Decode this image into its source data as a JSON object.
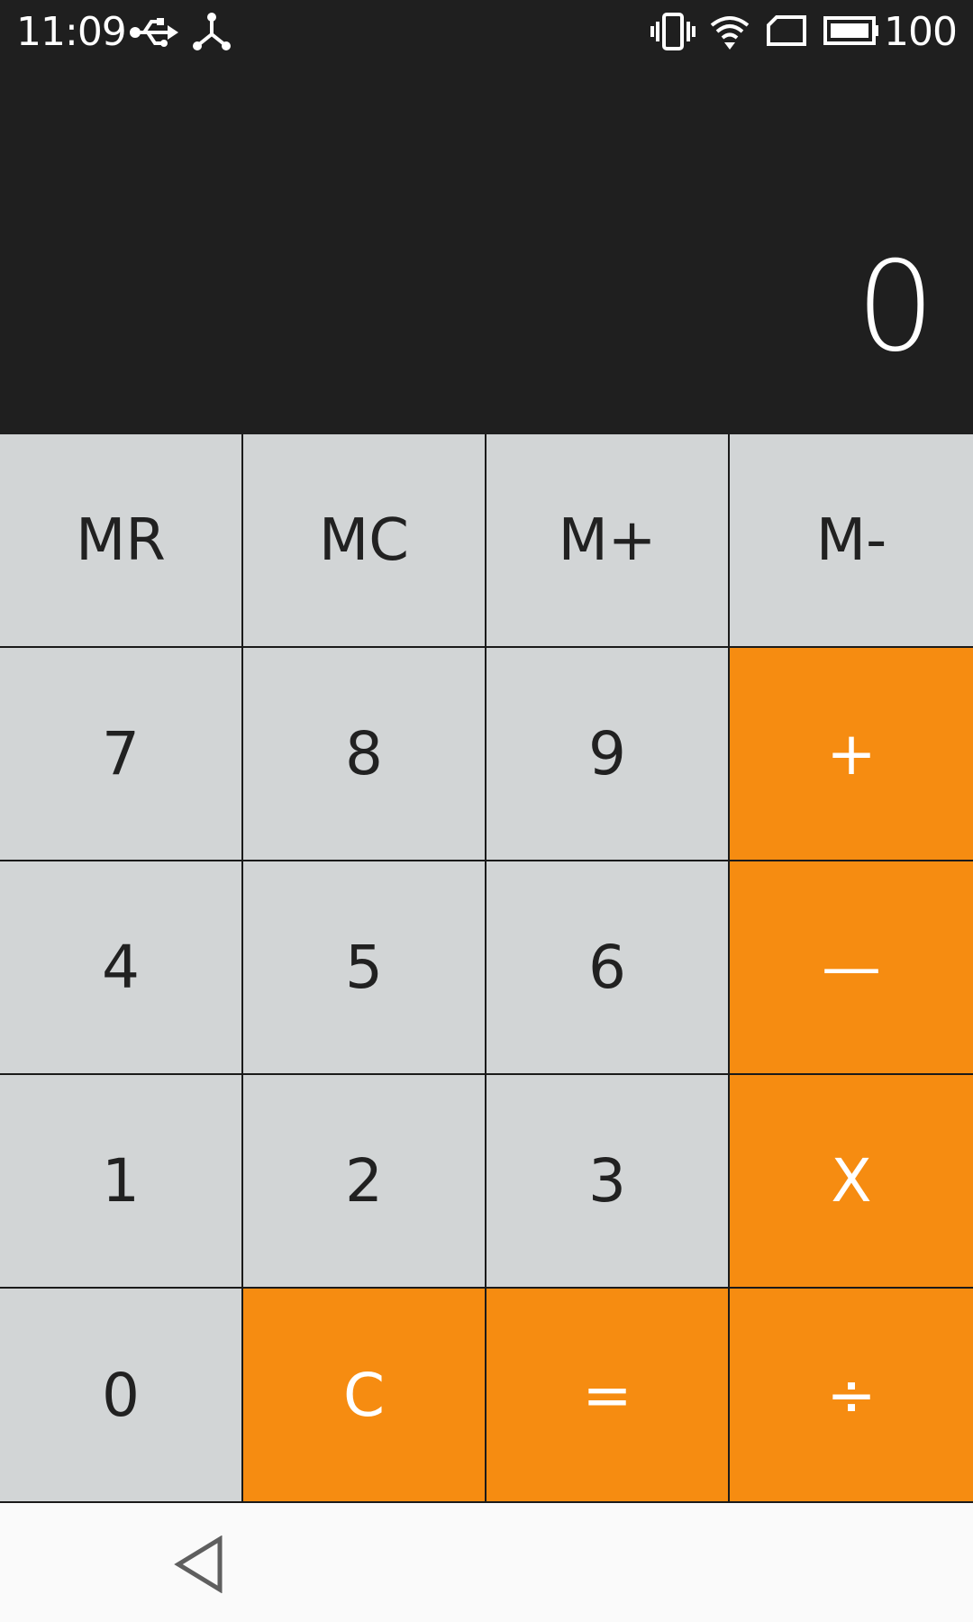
{
  "status_bar": {
    "time": "11:09",
    "icons_left": [
      "usb-icon",
      "share-icon"
    ],
    "icons_right": [
      "vibrate-icon",
      "wifi-icon",
      "sim-icon",
      "battery-icon"
    ],
    "battery_level": "100"
  },
  "display": {
    "value": "0"
  },
  "keypad": {
    "memory_row": [
      "MR",
      "MC",
      "M+",
      "M-"
    ],
    "rows": [
      [
        "7",
        "8",
        "9",
        "+"
      ],
      [
        "4",
        "5",
        "6",
        "—"
      ],
      [
        "1",
        "2",
        "3",
        "X"
      ],
      [
        "0",
        "C",
        "=",
        "÷"
      ]
    ]
  },
  "colors": {
    "display_bg": "#1f1f1f",
    "key_light": "#d2d5d6",
    "key_orange": "#f68c11",
    "key_text_dark": "#212121",
    "key_text_light": "#ffffff",
    "nav_bg": "#fafafa"
  },
  "navigation": {
    "back_icon": "back-triangle-icon"
  }
}
